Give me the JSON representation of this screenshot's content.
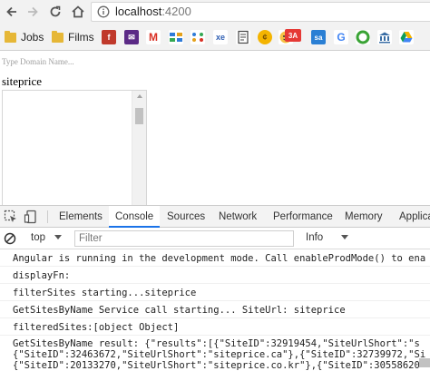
{
  "browser": {
    "url_host": "localhost",
    "url_port": ":4200"
  },
  "bookmarks": {
    "folders": [
      "Jobs",
      "Films"
    ]
  },
  "page": {
    "search_placeholder": "Type Domain Name...",
    "entered_text": "siteprice"
  },
  "devtools": {
    "tabs": [
      "Elements",
      "Console",
      "Sources",
      "Network",
      "Performance",
      "Memory",
      "Applica"
    ],
    "active_tab": "Console",
    "context": "top",
    "filter_placeholder": "Filter",
    "level": "Info",
    "logs": [
      "Angular is running in the development mode. Call enableProdMode() to ena",
      "displayFn:",
      "filterSites starting...siteprice",
      "GetSitesByName Service call starting... SiteUrl: siteprice",
      "filteredSites:[object Object]"
    ],
    "result_line1": "GetSitesByName result: {\"results\":[{\"SiteID\":32919454,\"SiteUrlShort\":\"s",
    "result_line2": "{\"SiteID\":32463672,\"SiteUrlShort\":\"siteprice.ca\"},{\"SiteID\":32739972,\"Si",
    "result_line3": "{\"SiteID\":20133270,\"SiteUrlShort\":\"siteprice.co.kr\"},{\"SiteID\":30558620"
  }
}
